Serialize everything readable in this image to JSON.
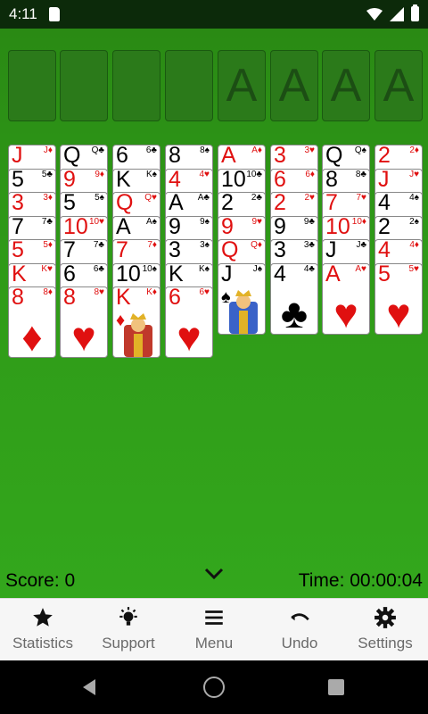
{
  "status_bar": {
    "time": "4:11"
  },
  "foundation": {
    "placeholder": "A"
  },
  "columns": [
    [
      {
        "rank": "J",
        "suit": "♦",
        "color": "red"
      },
      {
        "rank": "5",
        "suit": "♣",
        "color": "black"
      },
      {
        "rank": "3",
        "suit": "♦",
        "color": "red"
      },
      {
        "rank": "7",
        "suit": "♣",
        "color": "black"
      },
      {
        "rank": "5",
        "suit": "♦",
        "color": "red"
      },
      {
        "rank": "K",
        "suit": "♥",
        "color": "red"
      },
      {
        "rank": "8",
        "suit": "♦",
        "color": "red"
      }
    ],
    [
      {
        "rank": "Q",
        "suit": "♣",
        "color": "black"
      },
      {
        "rank": "9",
        "suit": "♦",
        "color": "red"
      },
      {
        "rank": "5",
        "suit": "♠",
        "color": "black"
      },
      {
        "rank": "10",
        "suit": "♥",
        "color": "red"
      },
      {
        "rank": "7",
        "suit": "♣",
        "color": "black"
      },
      {
        "rank": "6",
        "suit": "♣",
        "color": "black"
      },
      {
        "rank": "8",
        "suit": "♥",
        "color": "red"
      }
    ],
    [
      {
        "rank": "6",
        "suit": "♣",
        "color": "black"
      },
      {
        "rank": "K",
        "suit": "♠",
        "color": "black"
      },
      {
        "rank": "Q",
        "suit": "♥",
        "color": "red"
      },
      {
        "rank": "A",
        "suit": "♠",
        "color": "black"
      },
      {
        "rank": "7",
        "suit": "♦",
        "color": "red"
      },
      {
        "rank": "10",
        "suit": "♠",
        "color": "black"
      },
      {
        "rank": "K",
        "suit": "♦",
        "color": "red"
      }
    ],
    [
      {
        "rank": "8",
        "suit": "♠",
        "color": "black"
      },
      {
        "rank": "4",
        "suit": "♥",
        "color": "red"
      },
      {
        "rank": "A",
        "suit": "♣",
        "color": "black"
      },
      {
        "rank": "9",
        "suit": "♠",
        "color": "black"
      },
      {
        "rank": "3",
        "suit": "♠",
        "color": "black"
      },
      {
        "rank": "K",
        "suit": "♠",
        "color": "black"
      },
      {
        "rank": "6",
        "suit": "♥",
        "color": "red"
      }
    ],
    [
      {
        "rank": "A",
        "suit": "♦",
        "color": "red"
      },
      {
        "rank": "10",
        "suit": "♣",
        "color": "black"
      },
      {
        "rank": "2",
        "suit": "♣",
        "color": "black"
      },
      {
        "rank": "9",
        "suit": "♥",
        "color": "red"
      },
      {
        "rank": "Q",
        "suit": "♦",
        "color": "red"
      },
      {
        "rank": "J",
        "suit": "♠",
        "color": "black"
      }
    ],
    [
      {
        "rank": "3",
        "suit": "♥",
        "color": "red"
      },
      {
        "rank": "6",
        "suit": "♦",
        "color": "red"
      },
      {
        "rank": "2",
        "suit": "♥",
        "color": "red"
      },
      {
        "rank": "9",
        "suit": "♣",
        "color": "black"
      },
      {
        "rank": "3",
        "suit": "♣",
        "color": "black"
      },
      {
        "rank": "4",
        "suit": "♣",
        "color": "black"
      }
    ],
    [
      {
        "rank": "Q",
        "suit": "♠",
        "color": "black"
      },
      {
        "rank": "8",
        "suit": "♣",
        "color": "black"
      },
      {
        "rank": "7",
        "suit": "♥",
        "color": "red"
      },
      {
        "rank": "10",
        "suit": "♦",
        "color": "red"
      },
      {
        "rank": "J",
        "suit": "♣",
        "color": "black"
      },
      {
        "rank": "A",
        "suit": "♥",
        "color": "red"
      }
    ],
    [
      {
        "rank": "2",
        "suit": "♦",
        "color": "red"
      },
      {
        "rank": "J",
        "suit": "♥",
        "color": "red"
      },
      {
        "rank": "4",
        "suit": "♠",
        "color": "black"
      },
      {
        "rank": "2",
        "suit": "♠",
        "color": "black"
      },
      {
        "rank": "4",
        "suit": "♦",
        "color": "red"
      },
      {
        "rank": "5",
        "suit": "♥",
        "color": "red"
      }
    ]
  ],
  "score": "Score: 0",
  "timer": "Time: 00:00:04",
  "toolbar": [
    {
      "label": "Statistics",
      "icon": "star-icon"
    },
    {
      "label": "Support",
      "icon": "lightbulb-icon"
    },
    {
      "label": "Menu",
      "icon": "hamburger-menu-icon"
    },
    {
      "label": "Undo",
      "icon": "undo-icon"
    },
    {
      "label": "Settings",
      "icon": "gear-icon"
    }
  ],
  "colors": {
    "felt": "#2f9a18",
    "red_suit": "#e01010",
    "toolbar_bg": "#f6f6f6"
  }
}
